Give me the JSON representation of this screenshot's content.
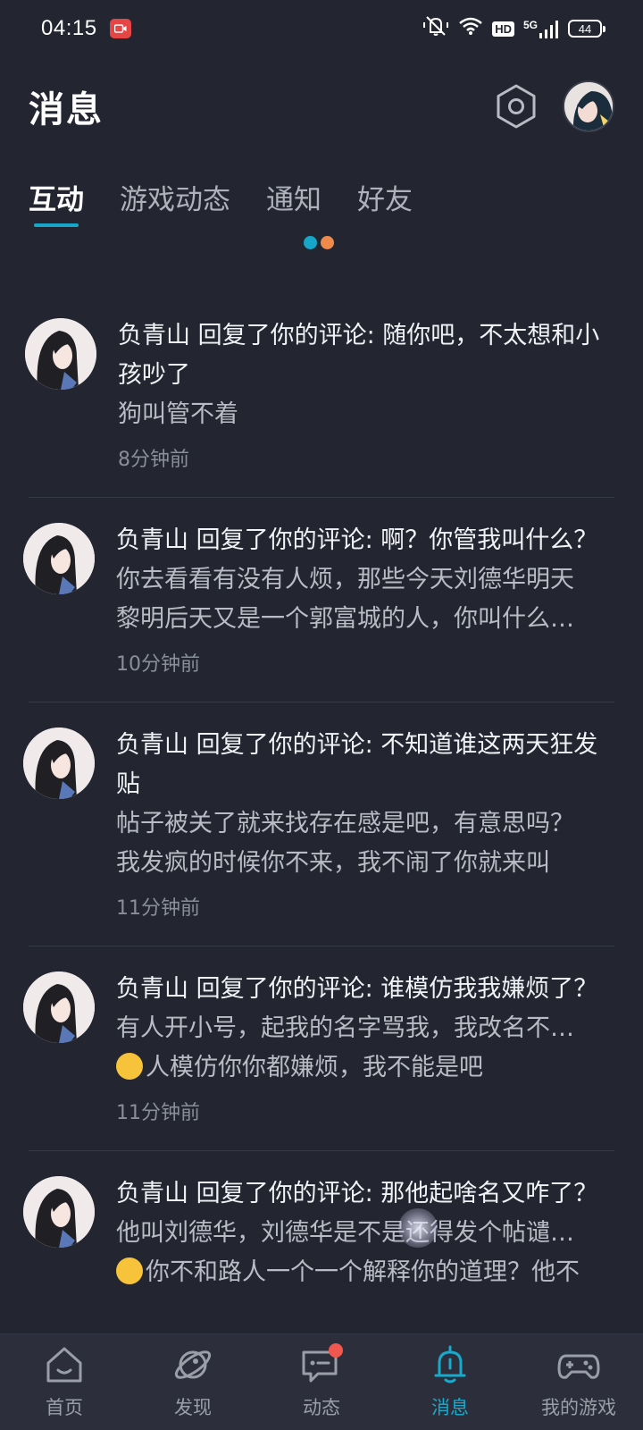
{
  "status_bar": {
    "time": "04:15",
    "hd": "HD",
    "network": "5G",
    "battery": "44"
  },
  "header": {
    "title": "消息",
    "settings_icon": "hexagon-settings-icon",
    "avatar_icon": "profile-avatar"
  },
  "tabs": [
    {
      "label": "互动",
      "active": true
    },
    {
      "label": "游戏动态",
      "active": false
    },
    {
      "label": "通知",
      "active": false
    },
    {
      "label": "好友",
      "active": false
    }
  ],
  "indicator_colors": {
    "dot1": "#17a6c7",
    "dot2": "#f08a4b"
  },
  "messages": [
    {
      "head": "负青山 回复了你的评论: 随你吧，不太想和小孩吵了",
      "lines": [
        "狗叫管不着"
      ],
      "time": "8分钟前"
    },
    {
      "head": "负青山 回复了你的评论: 啊？你管我叫什么？",
      "lines": [
        "你去看看有没有人烦，那些今天刘德华明天",
        "黎明后天又是一个郭富城的人，你叫什么…"
      ],
      "time": "10分钟前"
    },
    {
      "head": "负青山 回复了你的评论: 不知道谁这两天狂发贴",
      "lines": [
        "帖子被关了就来找存在感是吧，有意思吗？",
        "我发疯的时候你不来，我不闹了你就来叫"
      ],
      "time": "11分钟前"
    },
    {
      "head": "负青山 回复了你的评论: 谁模仿我我嫌烦了？",
      "lines": [
        "有人开小号，起我的名字骂我，我改名不…",
        "人模仿你你都嫌烦，我不能是吧"
      ],
      "time": "11分钟前"
    },
    {
      "head": "负青山 回复了你的评论: 那他起啥名又咋了？",
      "lines": [
        "他叫刘德华，刘德华是不是还得发个帖谴…",
        "你不和路人一个一个解释你的道理？他不"
      ],
      "time": ""
    }
  ],
  "bottom_nav": [
    {
      "label": "首页",
      "icon": "home-icon"
    },
    {
      "label": "发现",
      "icon": "planet-icon"
    },
    {
      "label": "动态",
      "icon": "chat-icon"
    },
    {
      "label": "消息",
      "icon": "bell-icon",
      "active": true
    },
    {
      "label": "我的游戏",
      "icon": "gamepad-icon"
    }
  ],
  "colors": {
    "background": "#232631",
    "accent": "#19a9cc",
    "badge": "#f0574e"
  }
}
